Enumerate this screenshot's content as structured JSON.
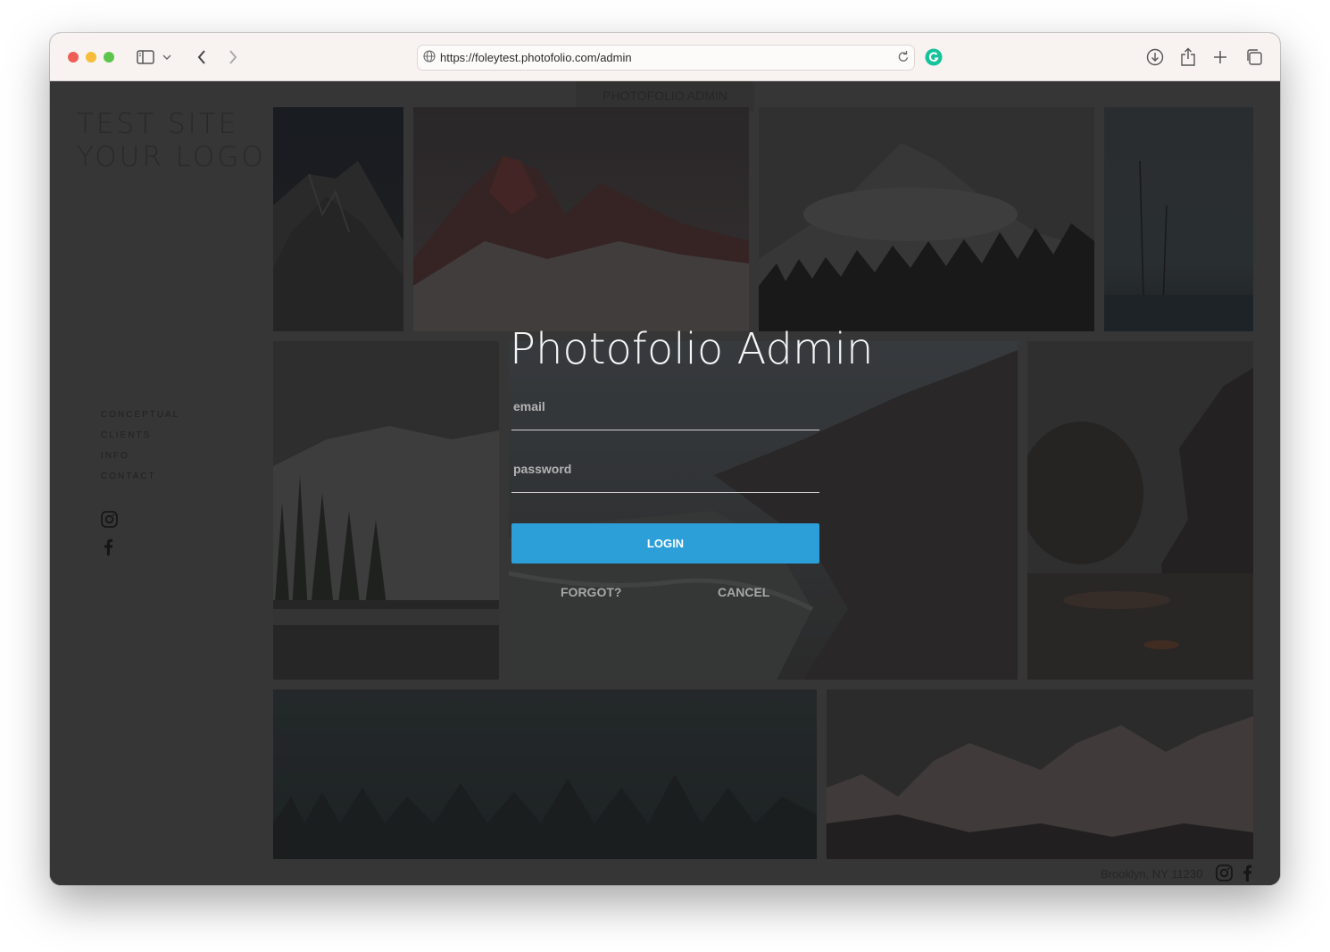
{
  "browser": {
    "url": "https://foleytest.photofolio.com/admin"
  },
  "site": {
    "top_label": "PHOTOFOLIO ADMIN",
    "logo_line1": "TEST SITE",
    "logo_line2": "YOUR LOGO",
    "nav": [
      "CONCEPTUAL",
      "CLIENTS",
      "INFO",
      "CONTACT"
    ],
    "footer_address": "Brooklyn, NY 11230"
  },
  "modal": {
    "title": "Photofolio Admin",
    "email_placeholder": "email",
    "password_placeholder": "password",
    "login_label": "LOGIN",
    "forgot_label": "FORGOT?",
    "cancel_label": "CANCEL"
  },
  "colors": {
    "accent": "#2c9fd9",
    "overlay": "#3b3b3b"
  },
  "icons": {
    "social": [
      "instagram-icon",
      "facebook-icon"
    ]
  }
}
